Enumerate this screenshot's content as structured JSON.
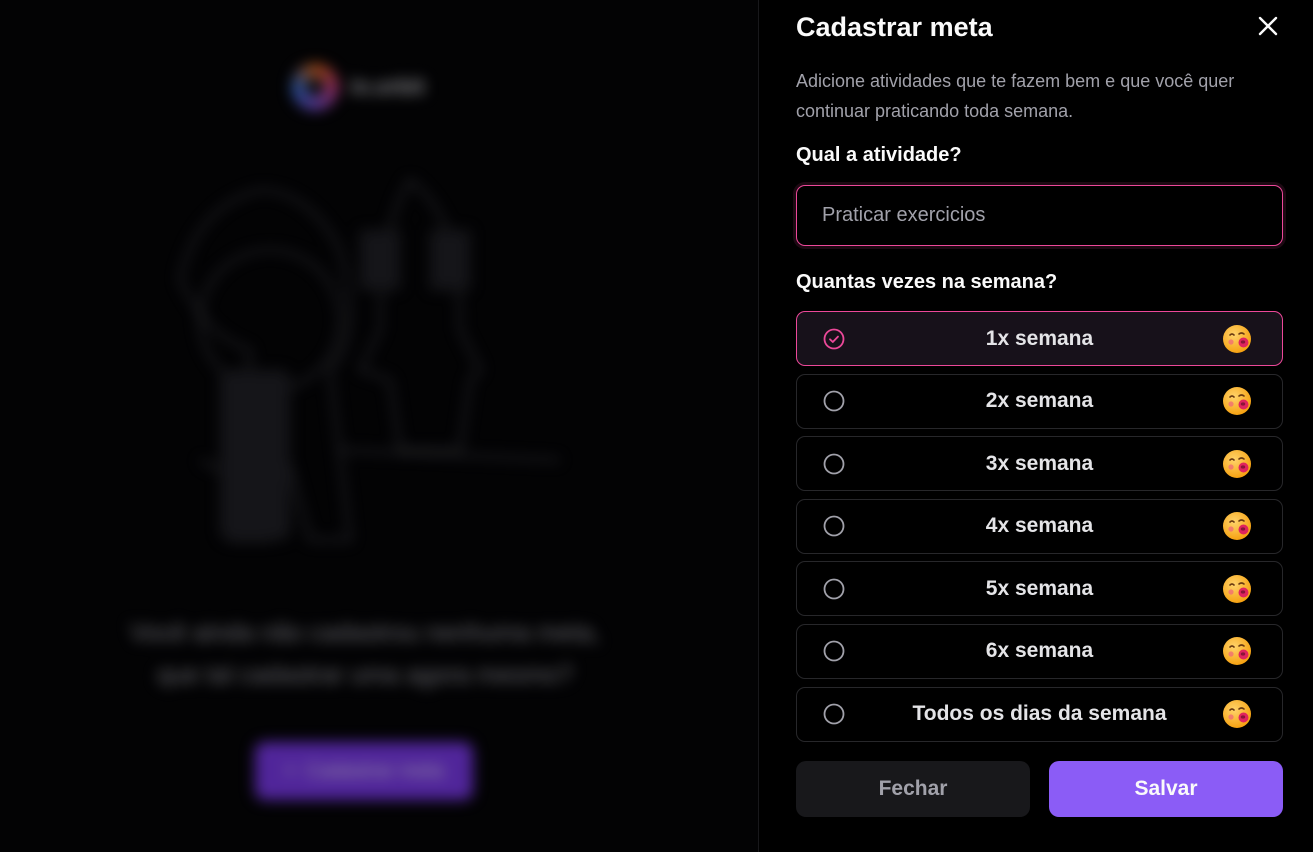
{
  "background": {
    "app_name": "in.orbit",
    "empty_message": "Você ainda não cadastrou nenhuma meta, que tal cadastrar uma agora mesmo?",
    "cta_label": "Cadastrar meta"
  },
  "panel": {
    "title": "Cadastrar meta",
    "description": "Adicione atividades que te fazem bem e que você quer continuar praticando toda semana.",
    "activity_label": "Qual a atividade?",
    "activity_placeholder": "Praticar exercicios",
    "activity_value": "",
    "frequency_label": "Quantas vezes na semana?",
    "options": [
      {
        "label": "1x semana",
        "selected": true
      },
      {
        "label": "2x semana",
        "selected": false
      },
      {
        "label": "3x semana",
        "selected": false
      },
      {
        "label": "4x semana",
        "selected": false
      },
      {
        "label": "5x semana",
        "selected": false
      },
      {
        "label": "6x semana",
        "selected": false
      },
      {
        "label": "Todos os dias da semana",
        "selected": false
      }
    ],
    "close_button": "Fechar",
    "save_button": "Salvar"
  },
  "colors": {
    "accent_pink": "#ec4899",
    "accent_violet": "#8b5cf6",
    "background": "#000000",
    "muted_text": "#a1a1aa"
  },
  "icons": {
    "close": "close-icon",
    "radio_selected": "check-circle-icon",
    "radio_unselected": "circle-icon",
    "option_emoji": "kissing-face-emoji-icon",
    "logo": "orbit-logo-icon"
  }
}
